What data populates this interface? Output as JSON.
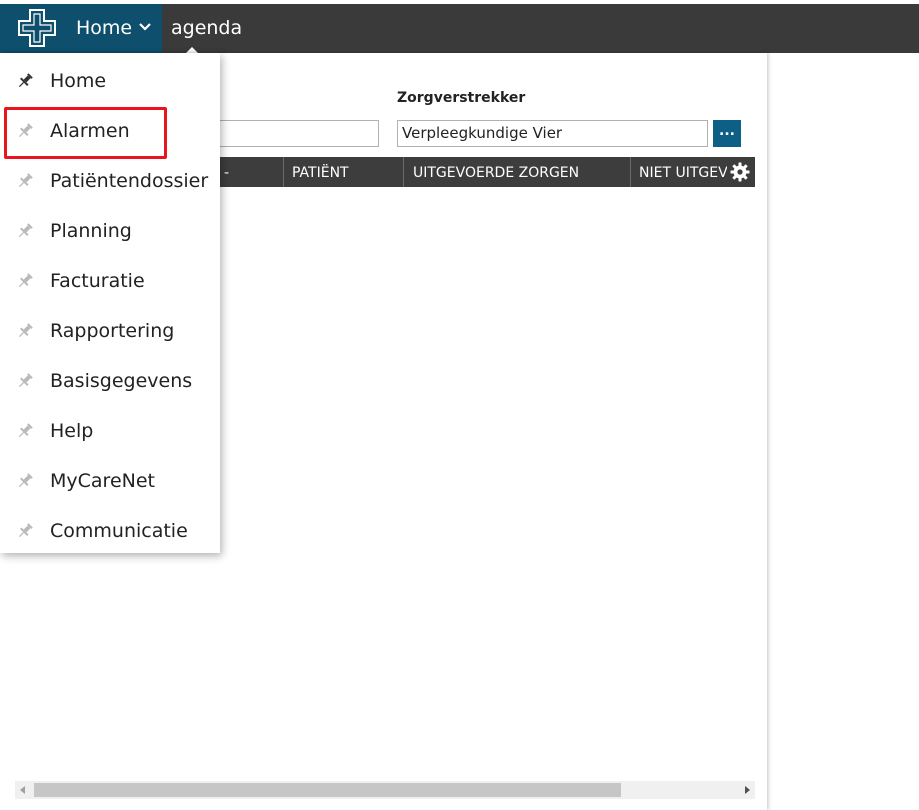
{
  "topbar": {
    "home_label": "Home",
    "section_label": "agenda",
    "home_color": "#0d4f6c",
    "bar_color": "#3a3a3a"
  },
  "form": {
    "zorgverstrekker_label": "Zorgverstrekker",
    "zorgverstrekker_value": "Verpleegkundige Vier",
    "picker_button_label": "..."
  },
  "grid": {
    "columns": [
      "-",
      "PATIËNT",
      "UITGEVOERDE ZORGEN",
      "NIET UITGEV"
    ],
    "header_color": "#3d3d3d"
  },
  "menu": {
    "items": [
      {
        "label": "Home",
        "pinned": true,
        "icon": "pin-icon"
      },
      {
        "label": "Alarmen",
        "pinned": false,
        "icon": "pin-icon"
      },
      {
        "label": "Patiëntendossier",
        "pinned": false,
        "icon": "pin-icon"
      },
      {
        "label": "Planning",
        "pinned": false,
        "icon": "pin-icon"
      },
      {
        "label": "Facturatie",
        "pinned": false,
        "icon": "pin-icon"
      },
      {
        "label": "Rapportering",
        "pinned": false,
        "icon": "pin-icon"
      },
      {
        "label": "Basisgegevens",
        "pinned": false,
        "icon": "pin-icon"
      },
      {
        "label": "Help",
        "pinned": false,
        "icon": "pin-icon"
      },
      {
        "label": "MyCareNet",
        "pinned": false,
        "icon": "pin-icon"
      },
      {
        "label": "Communicatie",
        "pinned": false,
        "icon": "pin-icon"
      }
    ],
    "highlighted_item": "Alarmen",
    "highlight_color": "#e8141e"
  }
}
